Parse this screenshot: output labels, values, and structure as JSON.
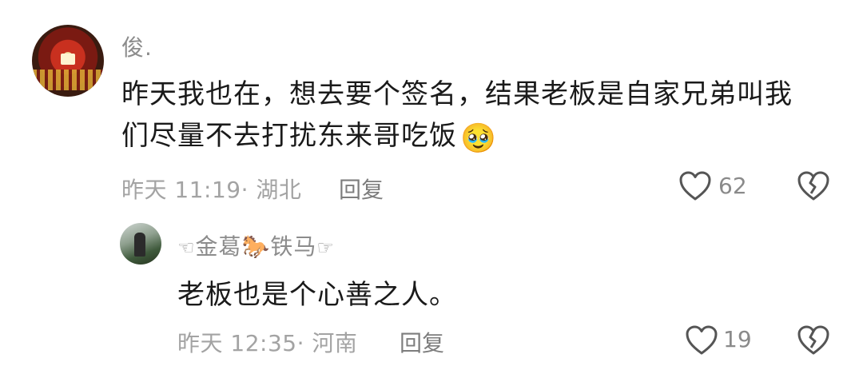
{
  "comments": [
    {
      "author": "俊.",
      "text_line1": "昨天我也在，想去要个签名，结果老板是自家兄弟叫我",
      "text_line2": "们尽量不去打扰东来哥吃饭",
      "text_emoji": "🥹",
      "time": "昨天 11:19",
      "location": "· 湖北",
      "reply_label": "回复",
      "like_count": "62"
    },
    {
      "author_prefix": "☜",
      "author_part1": "金葛",
      "author_emoji": "🐎",
      "author_part2": "铁马",
      "author_suffix": "☞",
      "text": "老板也是个心善之人。",
      "time": "昨天 12:35",
      "location": "· 河南",
      "reply_label": "回复",
      "like_count": "19"
    }
  ],
  "icons": {
    "like": "heart-outline-icon",
    "dislike": "broken-heart-outline-icon"
  },
  "colors": {
    "text_primary": "#1a1a1a",
    "text_secondary": "#a3a3a3",
    "icon_gray": "#555555"
  }
}
